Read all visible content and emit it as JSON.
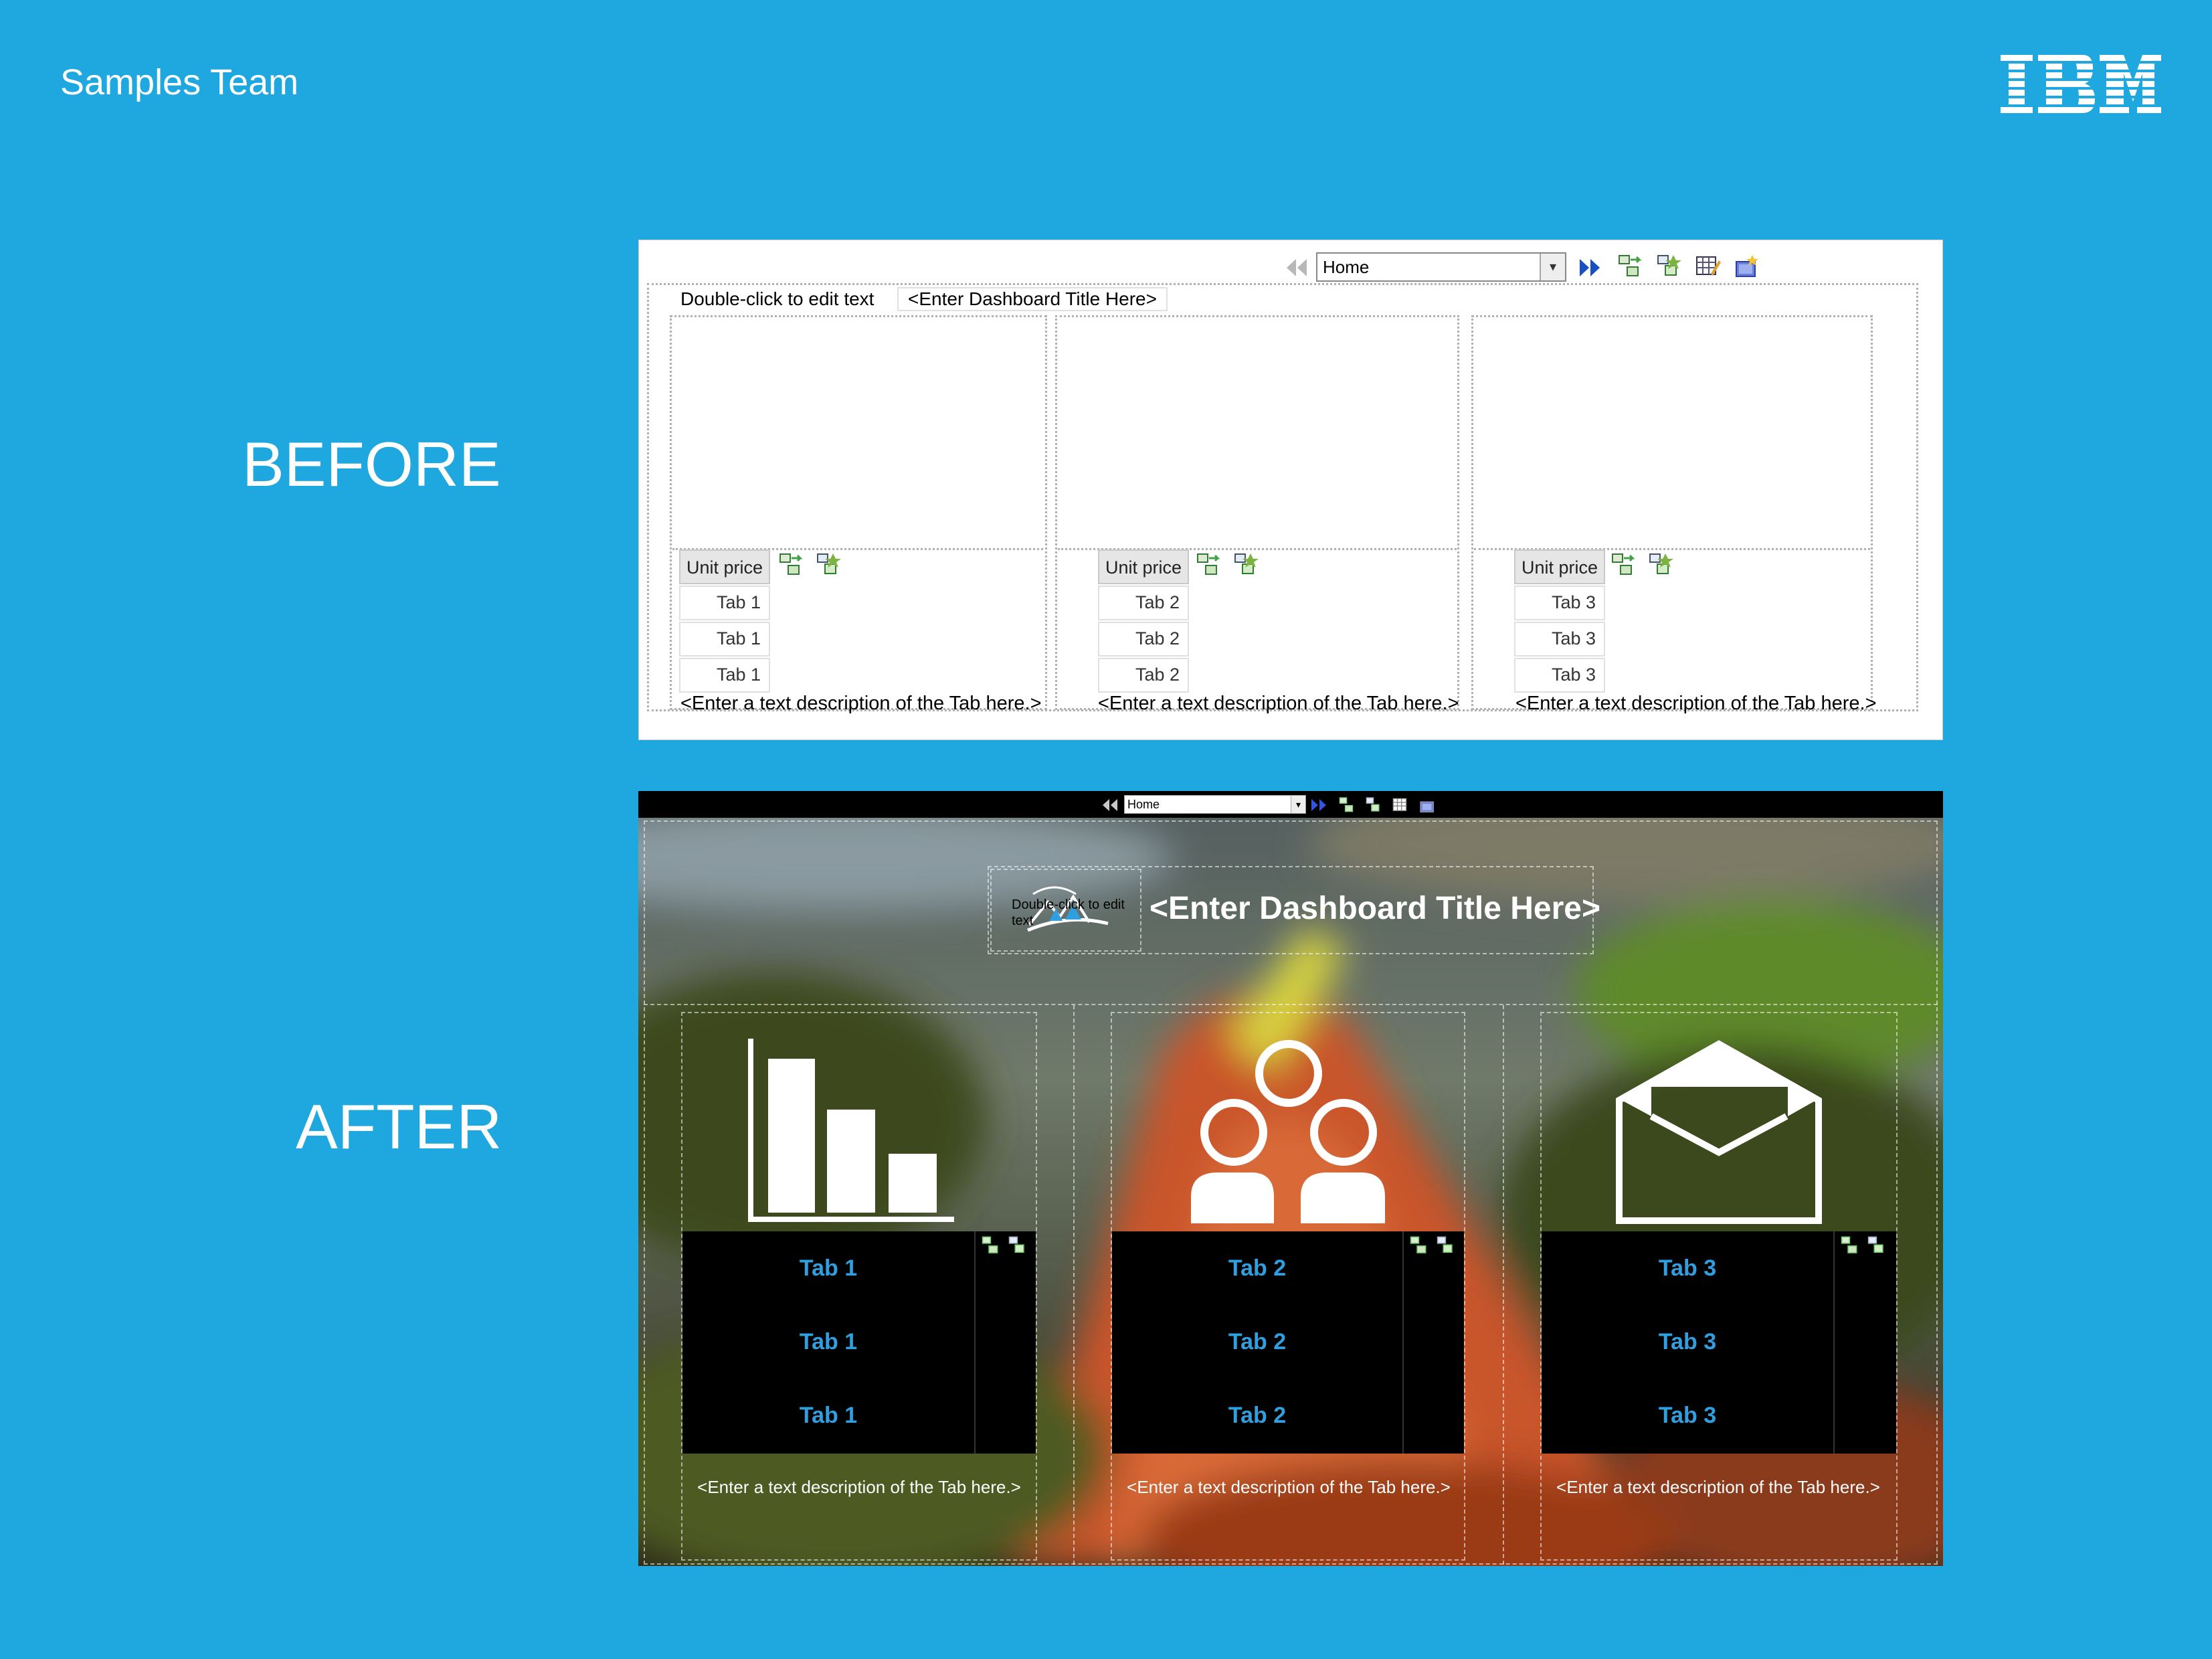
{
  "header": {
    "team": "Samples Team",
    "logo": "IBM"
  },
  "labels": {
    "before": "BEFORE",
    "after": "AFTER"
  },
  "before": {
    "nav_select": "Home",
    "title_hint": "Double-click to edit text",
    "title_placeholder": "<Enter Dashboard Title Here>",
    "columns": [
      {
        "header": "Unit price",
        "rows": [
          "Tab 1",
          "Tab 1",
          "Tab 1"
        ],
        "description": "<Enter a text description of the Tab here.>"
      },
      {
        "header": "Unit price",
        "rows": [
          "Tab 2",
          "Tab 2",
          "Tab 2"
        ],
        "description": "<Enter a text description of the Tab here.>"
      },
      {
        "header": "Unit price",
        "rows": [
          "Tab 3",
          "Tab 3",
          "Tab 3"
        ],
        "description": "<Enter a text description of the Tab here.>"
      }
    ]
  },
  "after": {
    "nav_select": "Home",
    "logo_hint": "Double-click to edit text",
    "title": "<Enter Dashboard Title Here>",
    "columns": [
      {
        "icon": "bar-chart-icon",
        "rows": [
          "Tab 1",
          "Tab 1",
          "Tab 1"
        ],
        "description": "<Enter a text description of the Tab here.>"
      },
      {
        "icon": "people-icon",
        "rows": [
          "Tab 2",
          "Tab 2",
          "Tab 2"
        ],
        "description": "<Enter a text description of the Tab here.>"
      },
      {
        "icon": "envelope-icon",
        "rows": [
          "Tab 3",
          "Tab 3",
          "Tab 3"
        ],
        "description": "<Enter a text description of the Tab here.>"
      }
    ],
    "accent": "#2F9FE0"
  },
  "colors": {
    "background": "#1FA7DF",
    "text": "#FFFFFF"
  }
}
